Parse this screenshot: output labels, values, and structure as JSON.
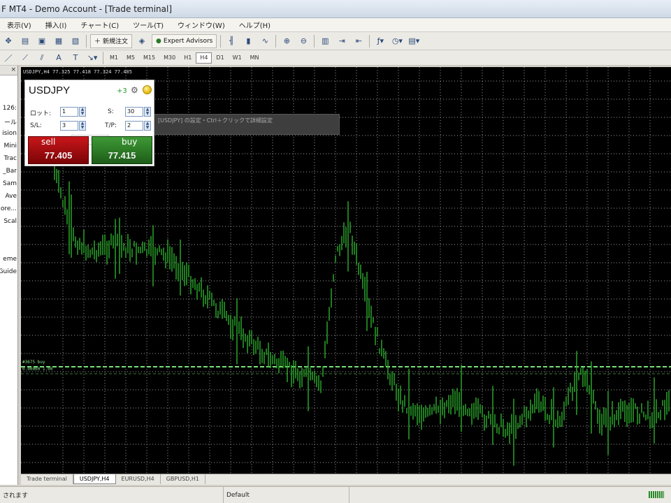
{
  "window": {
    "title": "F MT4 - Demo Account - [Trade terminal]"
  },
  "menu": [
    "表示(V)",
    "挿入(I)",
    "チャート(C)",
    "ツール(T)",
    "ウィンドウ(W)",
    "ヘルプ(H)"
  ],
  "toolbar": {
    "new_order": "新規注文",
    "expert_advisors": "Expert Advisors"
  },
  "timeframes": [
    "M1",
    "M5",
    "M15",
    "M30",
    "H1",
    "H4",
    "D1",
    "W1",
    "MN"
  ],
  "active_timeframe": "H4",
  "navigator": [
    "126:",
    "ール",
    "ision",
    "Mini",
    "Trac",
    "_Bar",
    "Sam",
    "Ave",
    "ore...",
    "Scal",
    "eme",
    "Guide"
  ],
  "chart": {
    "header": "USDJPY,H4  77.325 77.418 77.324 77.405",
    "order_line_label": "#3675 buy",
    "order_line_label2": "0.00000  1.00",
    "tooltip": "[USDJPY] の設定・Ctrl＋クリックで詳細設定",
    "colors": {
      "background": "#000000",
      "candles": "#2fb02f",
      "grid": "#9a9a9a",
      "order_line": "#7be07b"
    }
  },
  "one_click": {
    "symbol": "USDJPY",
    "spread": "+3",
    "lot_label": "ロット:",
    "lot_value": "1",
    "sl_label": "S/L:",
    "sl_value": "3",
    "right_top_label": "S:",
    "right_top_value": "30",
    "tp_label": "T/P:",
    "tp_value": "2",
    "quantity": "1.0",
    "sell_label": "sell",
    "sell_price": "77.405",
    "buy_label": "buy",
    "buy_price": "77.415"
  },
  "tabs": [
    "Trade terminal",
    "USDJPY,H4",
    "EURUSD,H4",
    "GBPUSD,H1"
  ],
  "active_tab": "USDJPY,H4",
  "status": {
    "left": "されます",
    "profile": "Default"
  }
}
